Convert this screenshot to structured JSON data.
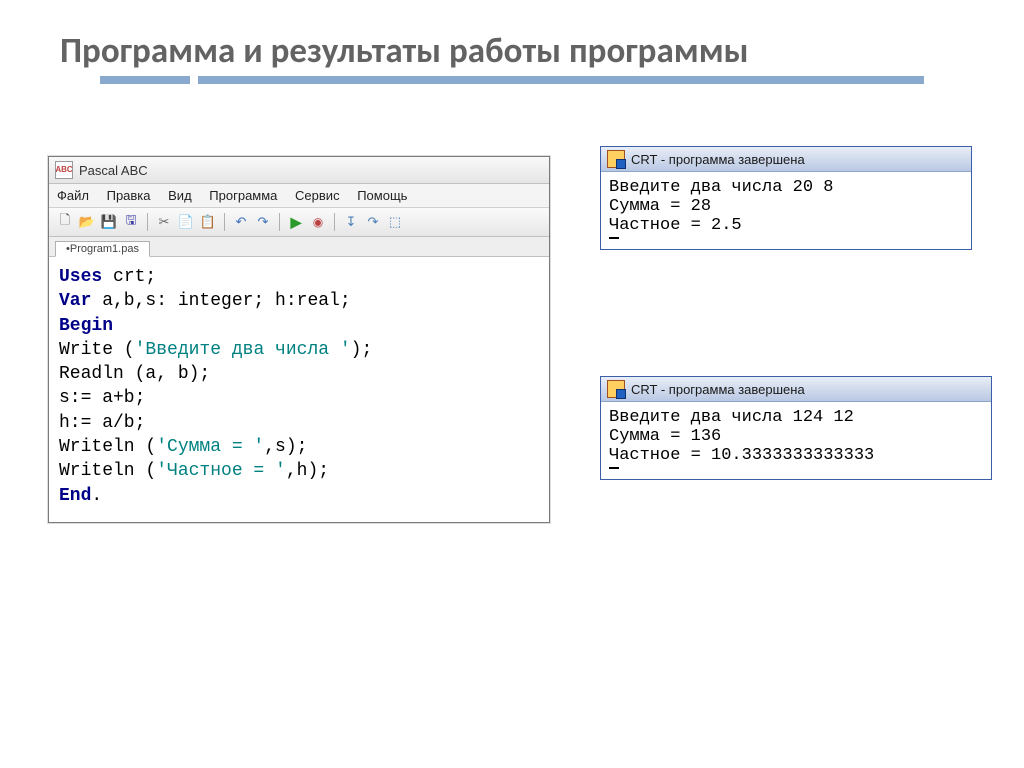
{
  "title": "Программа и результаты работы программы",
  "ide": {
    "app_title": "Pascal ABC",
    "app_icon_text": "ABC",
    "menu": [
      "Файл",
      "Правка",
      "Вид",
      "Программа",
      "Сервис",
      "Помощь"
    ],
    "toolbar_icons": {
      "new": "🗋",
      "open": "📂",
      "save": "💾",
      "save_all": "🖫",
      "cut": "✂",
      "copy": "📄",
      "paste": "📋",
      "undo": "↶",
      "redo": "↷",
      "run": "▶",
      "stop": "◉",
      "step_into": "↧",
      "step_over": "↷",
      "breakpoint": "⬚"
    },
    "file_tab": "•Program1.pas",
    "code": {
      "l1a": "Uses",
      "l1b": " crt;",
      "l2a": "Var",
      "l2b": " a,b,s: integer; h:real;",
      "l3": "Begin",
      "l4a": "Write (",
      "l4s": "'Введите два числа '",
      "l4b": ");",
      "l5": "Readln (a, b);",
      "l6": "s:= a+b;",
      "l7": "h:= a/b;",
      "l8a": "Writeln (",
      "l8s": "'Сумма = '",
      "l8b": ",s);",
      "l9a": "Writeln (",
      "l9s": "'Частное = '",
      "l9b": ",h);",
      "l10": "End",
      "l10b": "."
    }
  },
  "crt_title": "CRT - программа завершена",
  "crt1": {
    "line1": "Введите два числа 20 8",
    "line2": "Сумма = 28",
    "line3": "Частное = 2.5"
  },
  "crt2": {
    "line1": "Введите два числа 124 12",
    "line2": "Сумма = 136",
    "line3": "Частное = 10.3333333333333"
  }
}
